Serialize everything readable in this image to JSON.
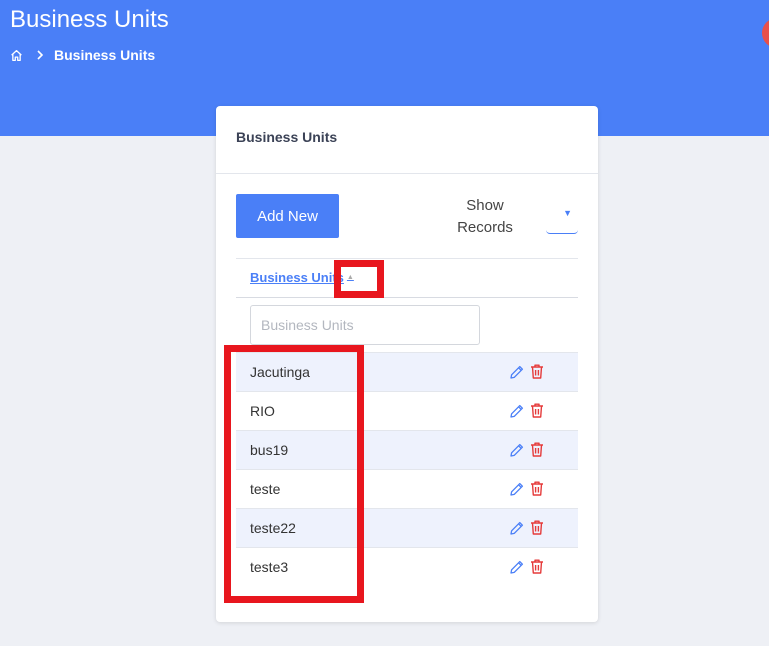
{
  "header": {
    "title": "Business Units",
    "breadcrumb": {
      "current": "Business Units"
    }
  },
  "card": {
    "title": "Business Units",
    "add_button": "Add New",
    "show_records_label": "Show Records"
  },
  "table": {
    "column_header": "Business Units",
    "filter_placeholder": "Business Units",
    "rows": [
      {
        "name": "Jacutinga"
      },
      {
        "name": "RIO"
      },
      {
        "name": "bus19"
      },
      {
        "name": "teste"
      },
      {
        "name": "teste22"
      },
      {
        "name": "teste3"
      }
    ]
  },
  "colors": {
    "brand": "#4a7ff7",
    "delete": "#e53a3a",
    "annotation": "#e8161e"
  }
}
